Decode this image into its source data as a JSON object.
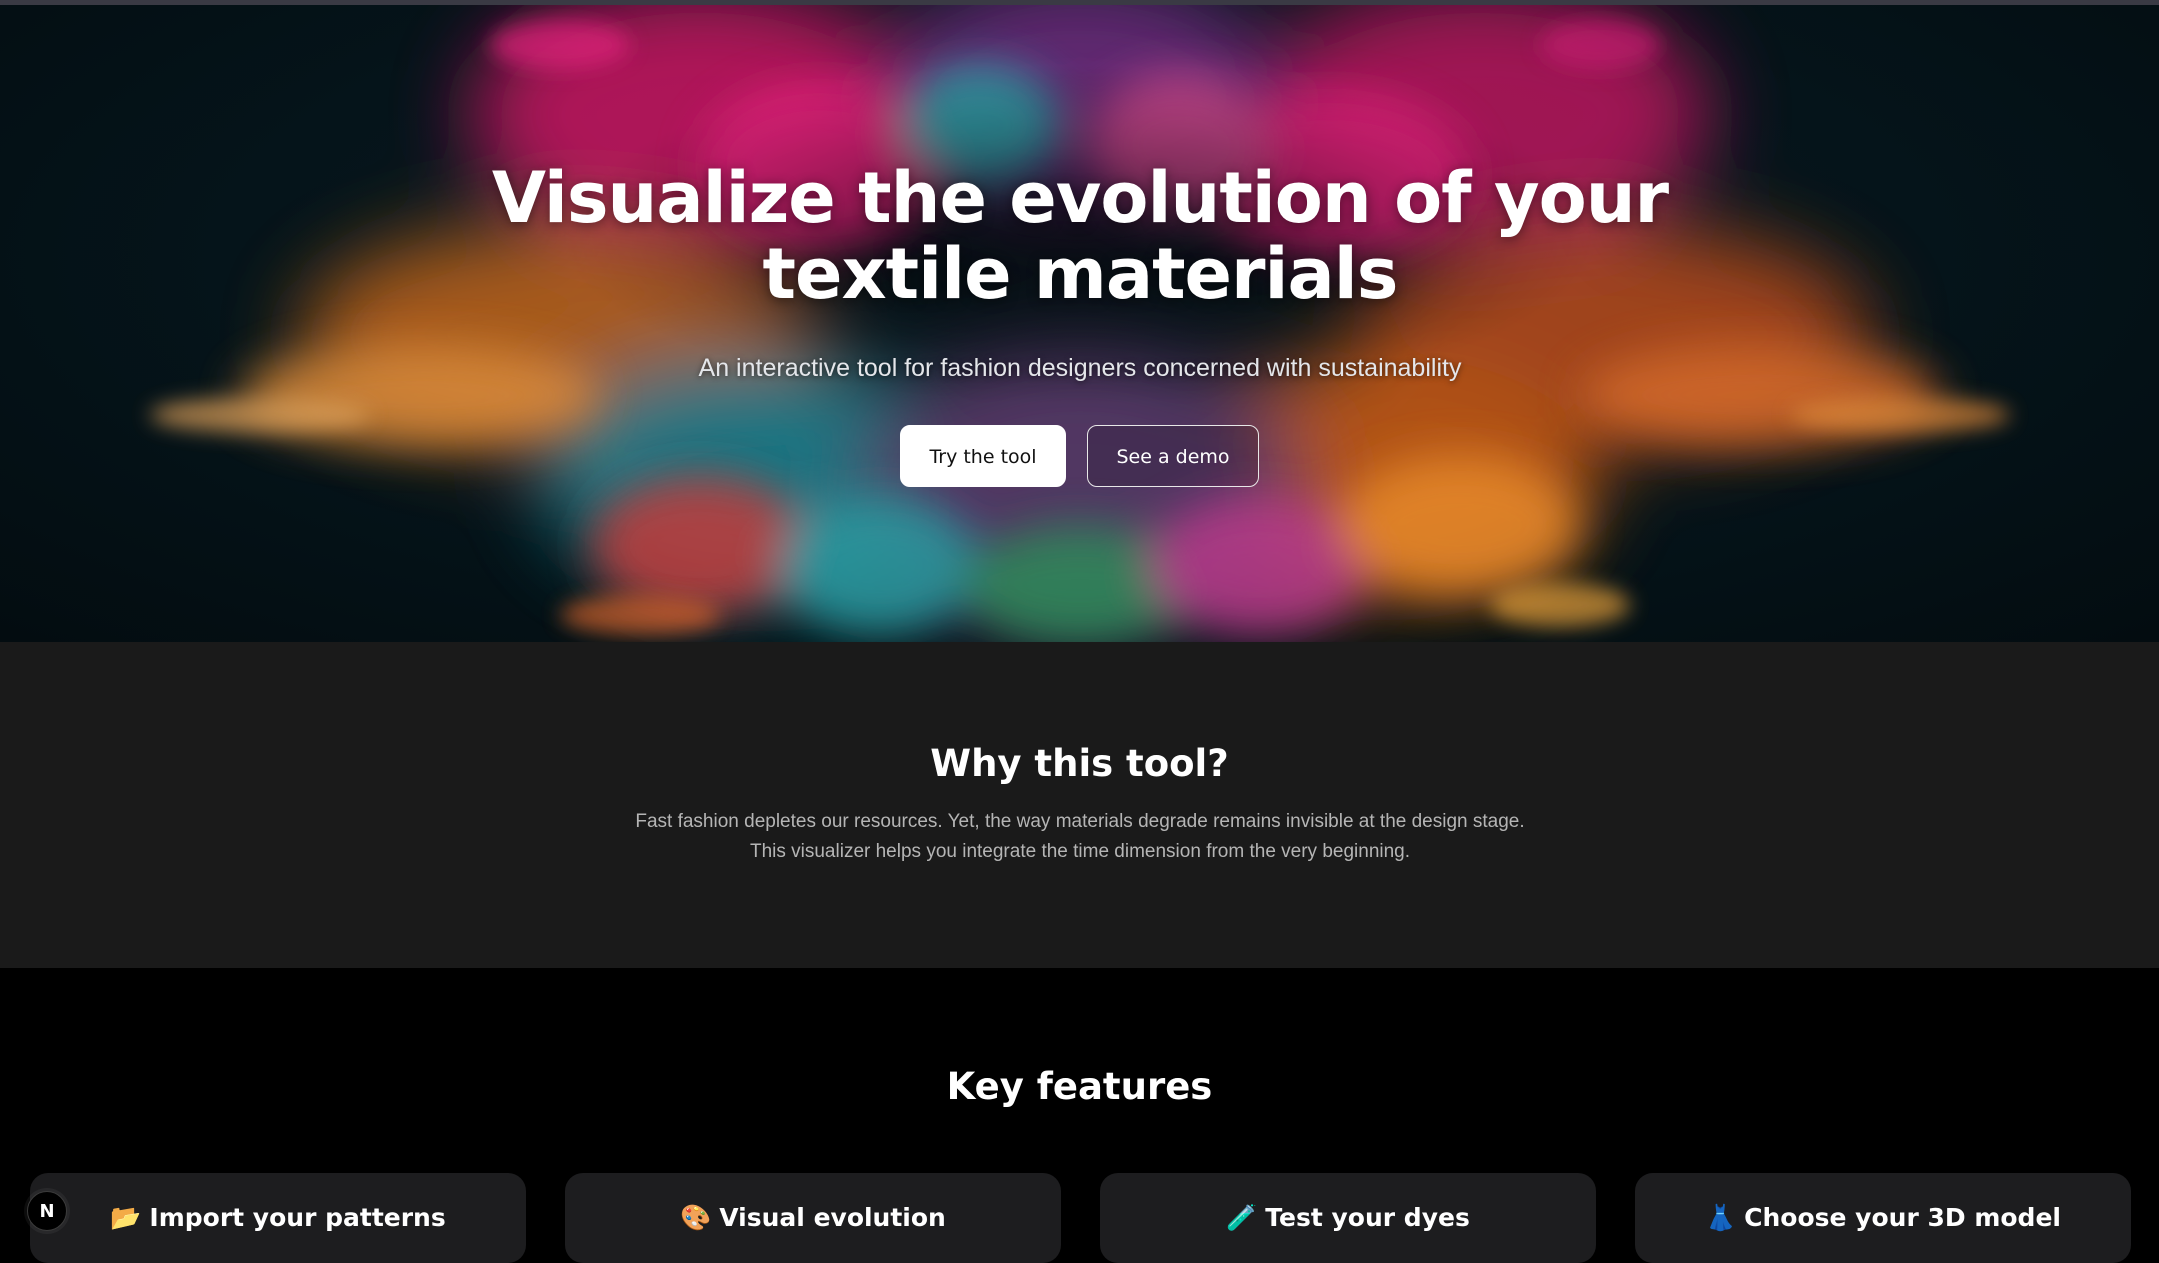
{
  "hero": {
    "title": "Visualize the evolution of your textile materials",
    "subtitle": "An interactive tool for fashion designers concerned with sustainability",
    "primary_button": "Try the tool",
    "secondary_button": "See a demo"
  },
  "why": {
    "title": "Why this tool?",
    "line1": "Fast fashion depletes our resources. Yet, the way materials degrade remains invisible at the design stage.",
    "line2": "This visualizer helps you integrate the time dimension from the very beginning."
  },
  "features": {
    "title": "Key features",
    "cards": [
      {
        "emoji": "📂",
        "label": "Import your patterns"
      },
      {
        "emoji": "🎨",
        "label": "Visual evolution"
      },
      {
        "emoji": "🧪",
        "label": "Test your dyes"
      },
      {
        "emoji": "👗",
        "label": "Choose your 3D model"
      }
    ]
  },
  "badge": {
    "letter": "N"
  },
  "colors": {
    "hero_bg": "#05141a",
    "why_bg": "#1a1a1a",
    "features_bg": "#000000",
    "card_bg": "#1d1d1f"
  }
}
